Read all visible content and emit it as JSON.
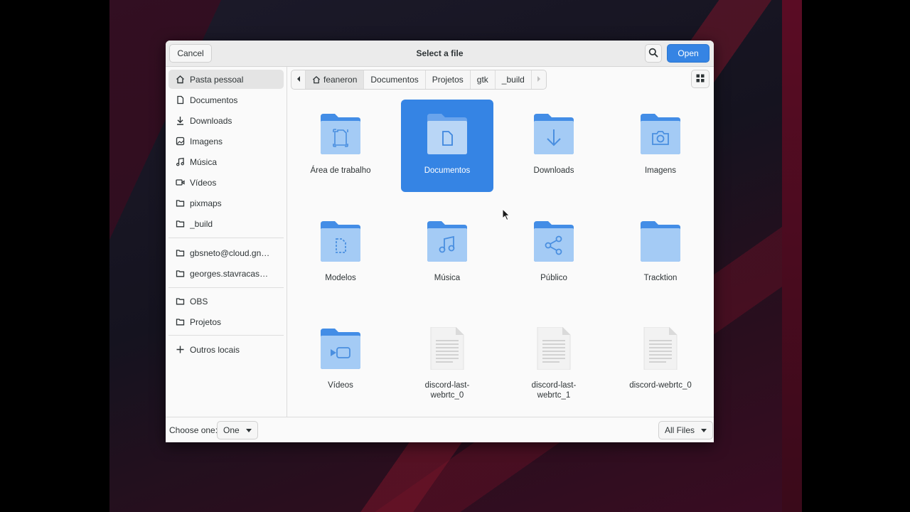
{
  "dialog": {
    "title": "Select a file",
    "cancel_label": "Cancel",
    "open_label": "Open",
    "accent_color": "#3584e4"
  },
  "sidebar": {
    "items": [
      {
        "label": "Pasta pessoal",
        "icon": "home-icon",
        "active": true
      },
      {
        "label": "Documentos",
        "icon": "document-icon"
      },
      {
        "label": "Downloads",
        "icon": "download-icon"
      },
      {
        "label": "Imagens",
        "icon": "image-icon"
      },
      {
        "label": "Música",
        "icon": "music-icon"
      },
      {
        "label": "Vídeos",
        "icon": "video-icon"
      },
      {
        "label": "pixmaps",
        "icon": "folder-icon"
      },
      {
        "label": "_build",
        "icon": "folder-icon"
      },
      {
        "label": "gbsneto@cloud.gno…",
        "icon": "network-folder-icon"
      },
      {
        "label": "georges.stavracas@…",
        "icon": "network-folder-icon"
      },
      {
        "label": "OBS",
        "icon": "folder-icon"
      },
      {
        "label": "Projetos",
        "icon": "folder-icon"
      },
      {
        "label": "Outros locais",
        "icon": "plus-icon"
      }
    ]
  },
  "pathbar": {
    "segments": [
      "feaneron",
      "Documentos",
      "Projetos",
      "gtk",
      "_build"
    ],
    "current": "feaneron"
  },
  "files": [
    {
      "label": "Área de trabalho",
      "icon": "desktop-folder-icon"
    },
    {
      "label": "Documentos",
      "icon": "documents-folder-icon",
      "selected": true
    },
    {
      "label": "Downloads",
      "icon": "downloads-folder-icon"
    },
    {
      "label": "Imagens",
      "icon": "pictures-folder-icon"
    },
    {
      "label": "Modelos",
      "icon": "templates-folder-icon"
    },
    {
      "label": "Música",
      "icon": "music-folder-icon"
    },
    {
      "label": "Público",
      "icon": "public-folder-icon"
    },
    {
      "label": "Tracktion",
      "icon": "folder-icon"
    },
    {
      "label": "Vídeos",
      "icon": "videos-folder-icon"
    },
    {
      "label": "discord-last-webrtc_0",
      "line1": "discord-last-",
      "line2": "webrtc_0",
      "icon": "text-file-icon"
    },
    {
      "label": "discord-last-webrtc_1",
      "line1": "discord-last-",
      "line2": "webrtc_1",
      "icon": "text-file-icon"
    },
    {
      "label": "discord-webrtc_0",
      "icon": "text-file-icon"
    }
  ],
  "footer": {
    "choose_label": "Choose one:",
    "choice_value": "One",
    "filter_value": "All Files"
  }
}
